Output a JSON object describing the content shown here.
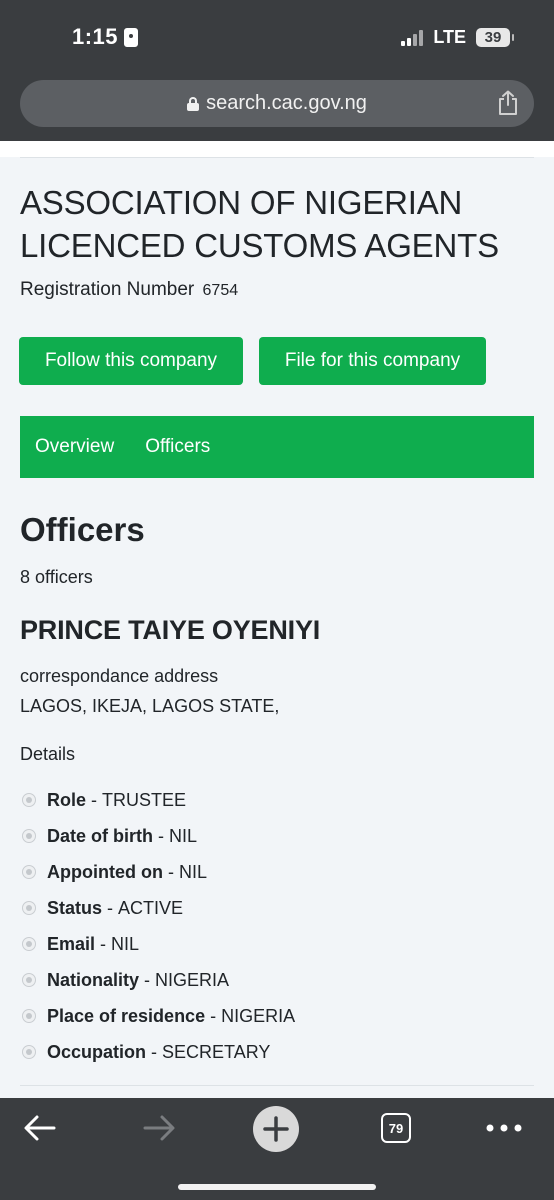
{
  "status_bar": {
    "time": "1:15",
    "network": "LTE",
    "battery": "39"
  },
  "browser": {
    "url": "search.cac.gov.ng",
    "tab_count": "79"
  },
  "company": {
    "name": "ASSOCIATION OF NIGERIAN LICENCED CUSTOMS AGENTS",
    "registration_label": "Registration Number",
    "registration_number": "6754"
  },
  "actions": {
    "follow_label": "Follow this company",
    "file_label": "File for this company"
  },
  "tabs": [
    {
      "label": "Overview"
    },
    {
      "label": "Officers"
    }
  ],
  "officers": {
    "heading": "Officers",
    "count_text": "8 officers",
    "first": {
      "name": "PRINCE TAIYE OYENIYI",
      "address_label": "correspondance address",
      "address": "LAGOS, IKEJA, LAGOS STATE,",
      "details_label": "Details",
      "details": [
        {
          "key": "Role",
          "value": "TRUSTEE"
        },
        {
          "key": "Date of birth",
          "value": "NIL"
        },
        {
          "key": "Appointed on",
          "value": "NIL"
        },
        {
          "key": "Status",
          "value": "ACTIVE"
        },
        {
          "key": "Email",
          "value": "NIL"
        },
        {
          "key": "Nationality",
          "value": "NIGERIA"
        },
        {
          "key": "Place of residence",
          "value": "NIGERIA"
        },
        {
          "key": "Occupation",
          "value": "SECRETARY"
        }
      ]
    }
  },
  "colors": {
    "brand_green": "#0fad4e",
    "chrome_dark": "#3a3d40",
    "page_bg": "#f2f5f8"
  },
  "icons": {
    "lock": "lock-icon",
    "share": "share-icon",
    "back": "arrow-left-icon",
    "forward": "arrow-right-icon",
    "new_tab": "plus-icon",
    "more": "ellipsis-icon"
  }
}
